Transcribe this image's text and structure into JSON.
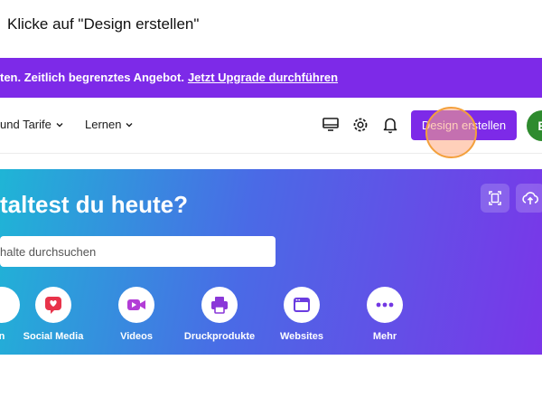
{
  "instruction": "Klicke auf \"Design erstellen\"",
  "banner": {
    "message": "ten. Zeitlich begrenztes Angebot.",
    "link": "Jetzt Upgrade durchführen",
    "color": "#7d2ae8"
  },
  "nav": {
    "items": [
      {
        "label": "und Tarife",
        "icon": "chevron-down-icon"
      },
      {
        "label": "Lernen",
        "icon": "chevron-down-icon"
      }
    ],
    "icons": [
      "desktop-icon",
      "gear-icon",
      "bell-icon"
    ],
    "design_button": "Design erstellen",
    "avatar_initial": "E",
    "accent": "#7d2ae8"
  },
  "hero": {
    "title": "taltest du heute?",
    "search_placeholder": "halte durchsuchen",
    "tools": [
      "resize-icon",
      "upload-cloud-icon"
    ],
    "categories": [
      {
        "label": "n",
        "icon": "partial-icon"
      },
      {
        "label": "Social Media",
        "icon": "heart-message-icon",
        "color": "#e8334a"
      },
      {
        "label": "Videos",
        "icon": "video-camera-icon",
        "color": "#b23dd6"
      },
      {
        "label": "Druckprodukte",
        "icon": "printer-icon",
        "color": "#8a38d8"
      },
      {
        "label": "Websites",
        "icon": "browser-window-icon",
        "color": "#6a3ce0"
      },
      {
        "label": "Mehr",
        "icon": "more-dots-icon",
        "color": "#7338e3"
      }
    ]
  }
}
